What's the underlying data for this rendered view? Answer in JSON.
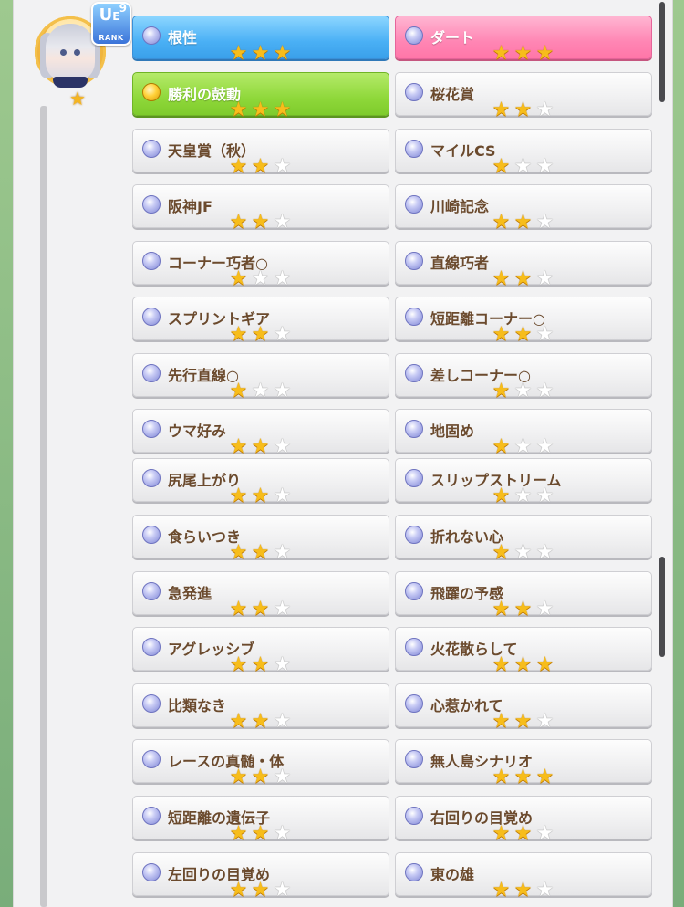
{
  "rank": {
    "letter": "U",
    "sub": "E",
    "number": "9",
    "label": "RANK"
  },
  "skills": [
    {
      "name": "根性",
      "stars": 3,
      "style": "blue",
      "icon": "blue-orb-icon"
    },
    {
      "name": "ダート",
      "stars": 3,
      "style": "pink",
      "icon": "blue-orb-icon"
    },
    {
      "name": "勝利の鼓動",
      "stars": 3,
      "style": "green",
      "icon": "gold-orb-icon"
    },
    {
      "name": "桜花賞",
      "stars": 2,
      "style": "plain",
      "icon": "blue-orb-icon"
    },
    {
      "name": "天皇賞（秋）",
      "stars": 2,
      "style": "plain",
      "icon": "blue-orb-icon"
    },
    {
      "name": "マイルCS",
      "stars": 1,
      "style": "plain",
      "icon": "blue-orb-icon"
    },
    {
      "name": "阪神JF",
      "stars": 2,
      "style": "plain",
      "icon": "blue-orb-icon"
    },
    {
      "name": "川崎記念",
      "stars": 2,
      "style": "plain",
      "icon": "blue-orb-icon"
    },
    {
      "name": "コーナー巧者○",
      "stars": 1,
      "style": "plain",
      "icon": "blue-orb-icon"
    },
    {
      "name": "直線巧者",
      "stars": 2,
      "style": "plain",
      "icon": "blue-orb-icon"
    },
    {
      "name": "スプリントギア",
      "stars": 2,
      "style": "plain",
      "icon": "blue-orb-icon"
    },
    {
      "name": "短距離コーナー○",
      "stars": 2,
      "style": "plain",
      "icon": "blue-orb-icon"
    },
    {
      "name": "先行直線○",
      "stars": 1,
      "style": "plain",
      "icon": "blue-orb-icon"
    },
    {
      "name": "差しコーナー○",
      "stars": 1,
      "style": "plain",
      "icon": "blue-orb-icon"
    },
    {
      "name": "ウマ好み",
      "stars": 2,
      "style": "plain",
      "icon": "blue-orb-icon"
    },
    {
      "name": "地固め",
      "stars": 1,
      "style": "plain",
      "icon": "blue-orb-icon"
    },
    {
      "name": "尻尾上がり",
      "stars": 2,
      "style": "plain",
      "icon": "blue-orb-icon"
    },
    {
      "name": "スリップストリーム",
      "stars": 1,
      "style": "plain",
      "icon": "blue-orb-icon"
    },
    {
      "name": "食らいつき",
      "stars": 2,
      "style": "plain",
      "icon": "blue-orb-icon"
    },
    {
      "name": "折れない心",
      "stars": 1,
      "style": "plain",
      "icon": "blue-orb-icon"
    },
    {
      "name": "急発進",
      "stars": 2,
      "style": "plain",
      "icon": "blue-orb-icon"
    },
    {
      "name": "飛躍の予感",
      "stars": 2,
      "style": "plain",
      "icon": "blue-orb-icon"
    },
    {
      "name": "アグレッシブ",
      "stars": 2,
      "style": "plain",
      "icon": "blue-orb-icon"
    },
    {
      "name": "火花散らして",
      "stars": 3,
      "style": "plain",
      "icon": "blue-orb-icon"
    },
    {
      "name": "比類なき",
      "stars": 2,
      "style": "plain",
      "icon": "blue-orb-icon"
    },
    {
      "name": "心惹かれて",
      "stars": 2,
      "style": "plain",
      "icon": "blue-orb-icon"
    },
    {
      "name": "レースの真髄・体",
      "stars": 2,
      "style": "plain",
      "icon": "blue-orb-icon"
    },
    {
      "name": "無人島シナリオ",
      "stars": 3,
      "style": "plain",
      "icon": "blue-orb-icon"
    },
    {
      "name": "短距離の遺伝子",
      "stars": 2,
      "style": "plain",
      "icon": "blue-orb-icon"
    },
    {
      "name": "右回りの目覚め",
      "stars": 2,
      "style": "plain",
      "icon": "blue-orb-icon"
    },
    {
      "name": "左回りの目覚め",
      "stars": 2,
      "style": "plain",
      "icon": "blue-orb-icon"
    },
    {
      "name": "東の雄",
      "stars": 2,
      "style": "plain",
      "icon": "blue-orb-icon"
    }
  ],
  "colors": {
    "accent_blue": "#4ab0f5",
    "accent_pink": "#ff86b4",
    "accent_green": "#8fd83a",
    "star": "#f7bd1b",
    "text": "#6b4a2d"
  }
}
